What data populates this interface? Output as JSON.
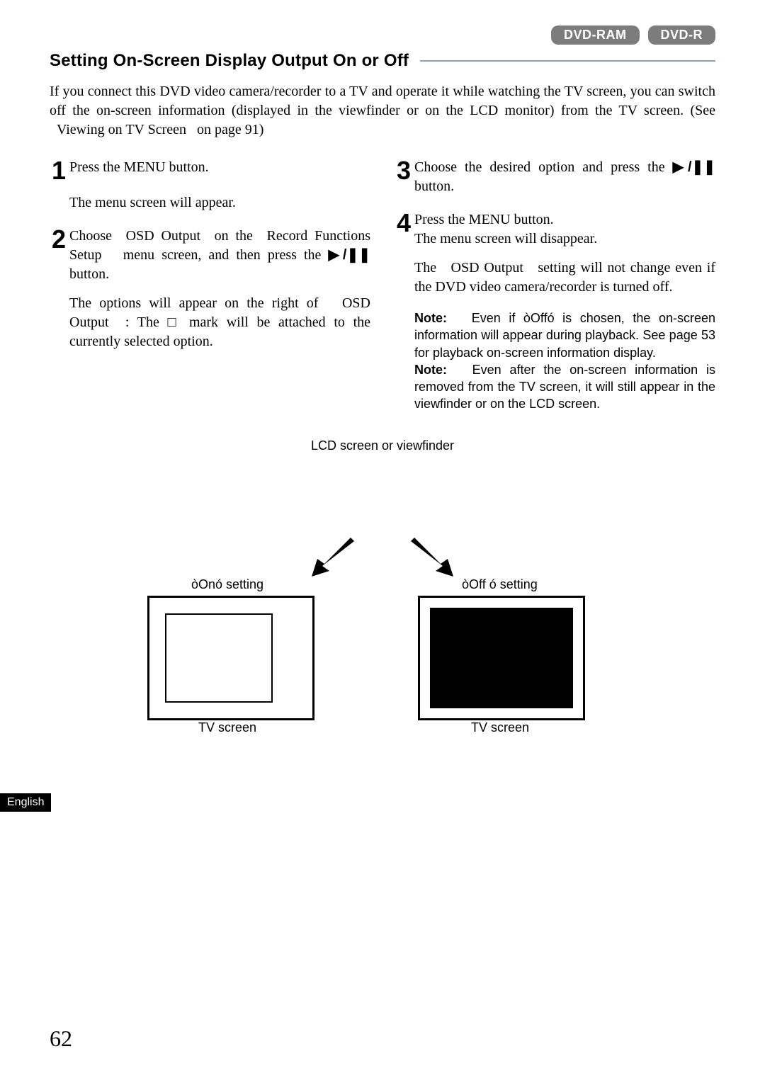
{
  "badges": {
    "ram": "DVD-RAM",
    "r": "DVD-R"
  },
  "title": "Setting On-Screen Display Output On or Off",
  "intro": "If you connect this DVD video camera/recorder to a TV and operate it while watching the TV screen, you can switch off the on-screen information (displayed in the viewfinder or on the LCD monitor) from the TV screen. (See   Viewing on TV Screen   on page 91)",
  "steps": {
    "n1": "1",
    "s1a": "Press the MENU button.",
    "s1b": "The menu screen will appear.",
    "n2": "2",
    "s2a_pre": "Choose  OSD Output  on the  Record Functions Setup   menu screen, and then press the ",
    "s2a_post": " button.",
    "s2b": "The options will appear on the right of   OSD Output  : The □ mark will be attached to the currently selected option.",
    "n3": "3",
    "s3_pre": "Choose the desired option and press the ",
    "s3_post": " button.",
    "n4": "4",
    "s4a": "Press the MENU button.",
    "s4b": "The menu screen will disappear.",
    "s4c": "The   OSD Output   setting will not change even if the DVD video camera/recorder is turned off."
  },
  "notes": {
    "label": "Note:",
    "n1": "   Even if òOffó is chosen, the on-screen information will appear during playback. See page 53 for playback on-screen information display.",
    "n2": "   Even after the on-screen information is removed from the TV screen, it will still appear in the viewfinder or on the LCD screen."
  },
  "diagram": {
    "lcd": "LCD screen or viewfinder",
    "on": "òOnó setting",
    "off": "òOff ó setting",
    "tv": "TV screen"
  },
  "lang": "English",
  "pagenum": "62",
  "icon": "▶/❚❚"
}
